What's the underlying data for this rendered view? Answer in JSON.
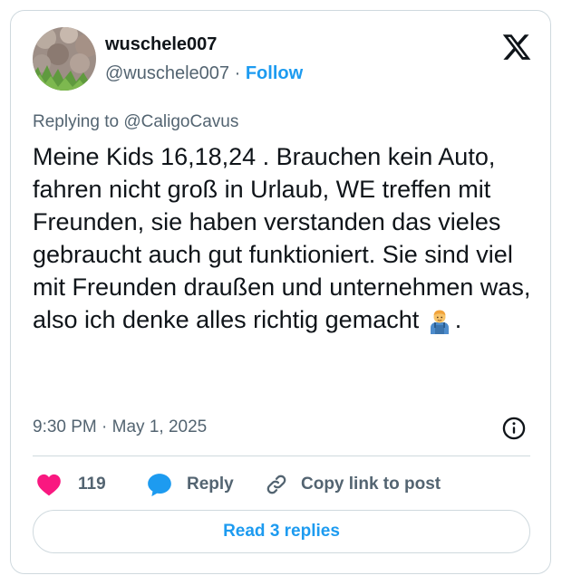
{
  "author": {
    "display_name": "wuschele007",
    "handle": "@wuschele007",
    "separator": " · ",
    "follow_label": "Follow"
  },
  "reply_context": {
    "prefix": "Replying to ",
    "mention": "@CaligoCavus"
  },
  "tweet": {
    "text": "Meine Kids 16,18,24 . Brauchen kein Auto, fahren nicht groß in Urlaub, WE treffen mit Freunden, sie haben verstanden das vieles gebraucht auch gut funktioniert. Sie sind viel mit Freunden draußen und unternehmen was, also ich denke alles richtig gemacht",
    "trailing_emoji": "man-mechanic-emoji",
    "trailing_text": ".",
    "timestamp": "9:30 PM · May 1, 2025"
  },
  "actions": {
    "like_count": "119",
    "reply_label": "Reply",
    "copy_link_label": "Copy link to post"
  },
  "read_replies_label": "Read 3 replies",
  "colors": {
    "accent": "#1d9bf0",
    "like": "#f91880",
    "text_primary": "#0f1419",
    "text_secondary": "#536471",
    "border": "#cfd9de"
  },
  "icons": {
    "brand": "x-logo-icon",
    "info": "info-icon",
    "like": "heart-icon",
    "reply": "speech-bubble-icon",
    "copy": "link-icon"
  }
}
